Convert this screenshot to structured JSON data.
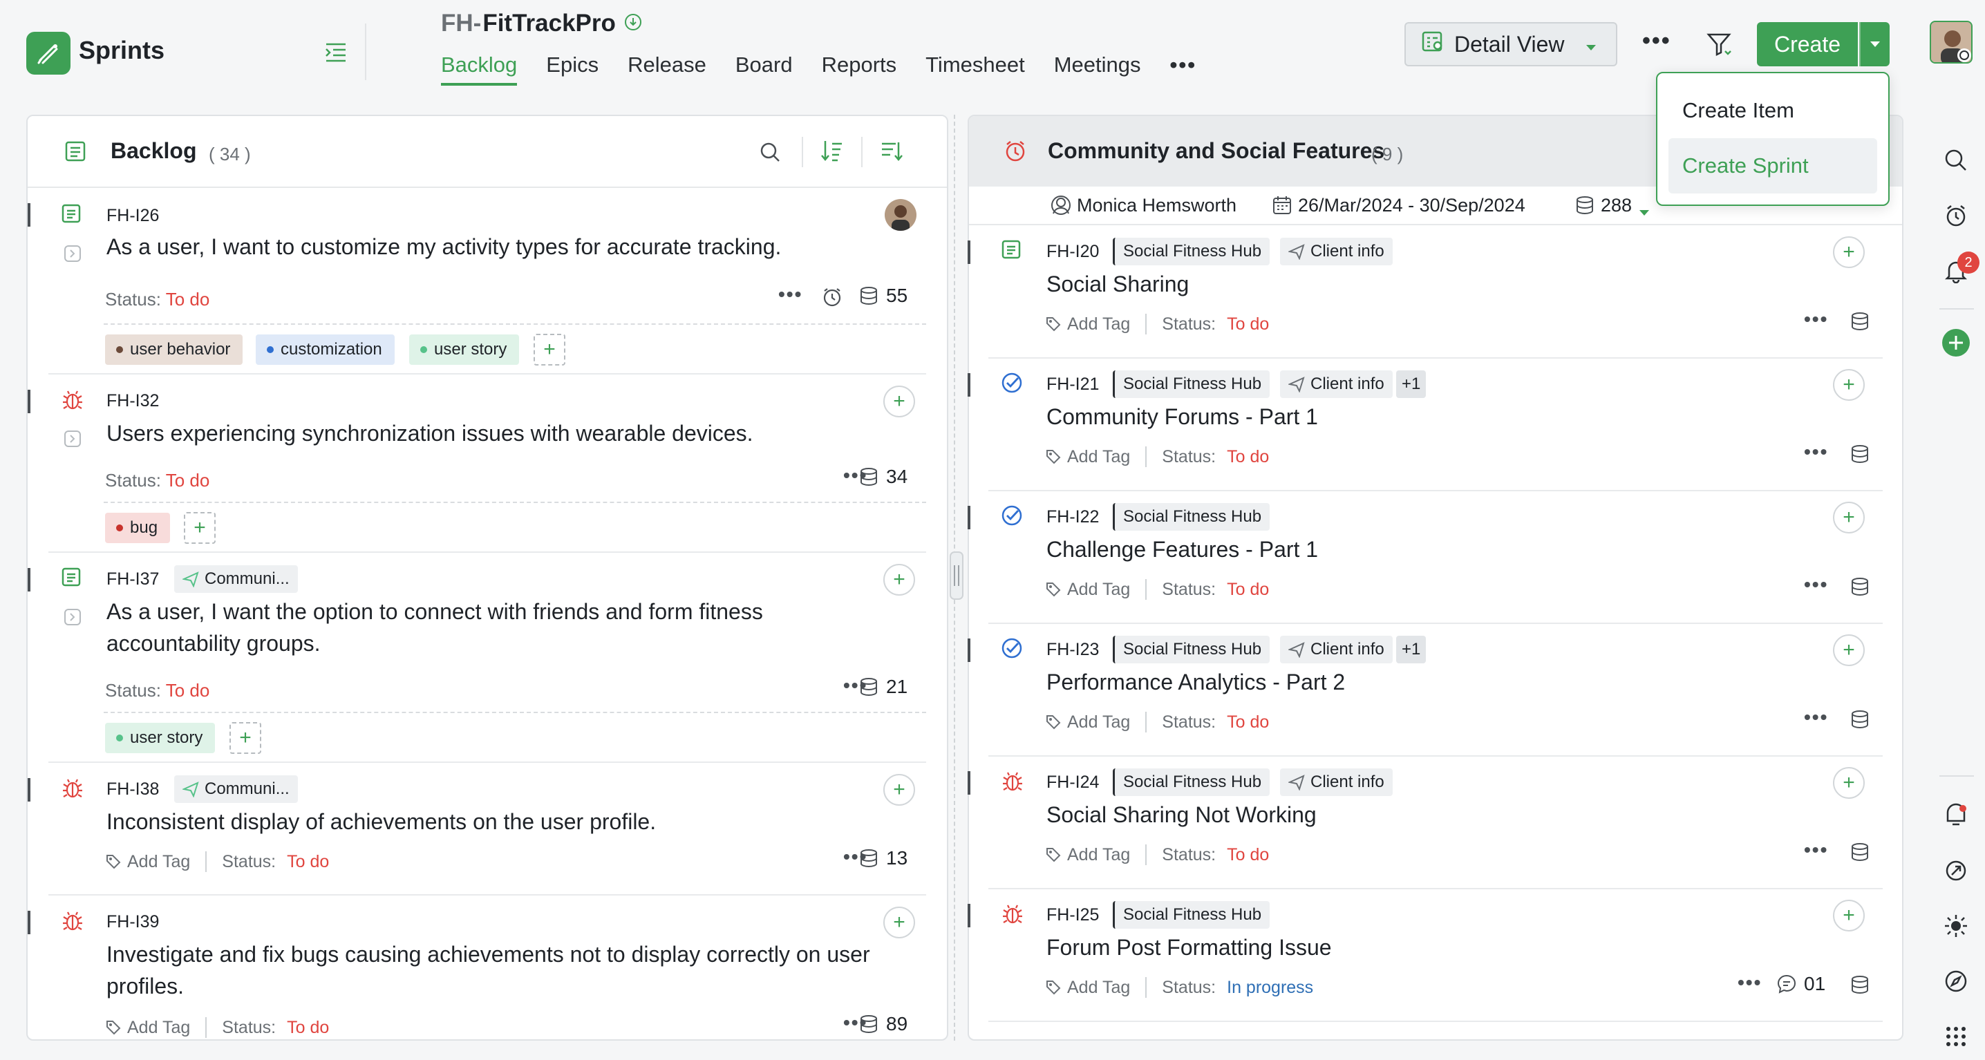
{
  "app": {
    "name": "Sprints"
  },
  "project": {
    "prefix": "FH-",
    "name": "FitTrackPro"
  },
  "nav": {
    "tabs": [
      {
        "label": "Backlog",
        "active": true
      },
      {
        "label": "Epics"
      },
      {
        "label": "Release"
      },
      {
        "label": "Board"
      },
      {
        "label": "Reports"
      },
      {
        "label": "Timesheet"
      },
      {
        "label": "Meetings"
      }
    ],
    "more": "•••"
  },
  "toolbar": {
    "view_label": "Detail View",
    "more": "•••",
    "create_label": "Create"
  },
  "create_menu": {
    "items": [
      {
        "label": "Create Item"
      },
      {
        "label": "Create Sprint",
        "highlighted": true
      }
    ]
  },
  "rail": {
    "notification_count": "2"
  },
  "backlog": {
    "title": "Backlog",
    "count": "( 34 )",
    "items": [
      {
        "id": "FH-I26",
        "type": "story",
        "title": "As a user, I want to customize my activity types for accurate tracking.",
        "status_label": "Status:",
        "status": "To do",
        "points": "55",
        "tags": [
          {
            "label": "user behavior",
            "color": "#6b4a3a",
            "bg": "#eadfd8"
          },
          {
            "label": "customization",
            "color": "#2f6fd1",
            "bg": "#dfe9f8"
          },
          {
            "label": "user story",
            "color": "#57c28a",
            "bg": "#dff3e8"
          }
        ]
      },
      {
        "id": "FH-I32",
        "type": "bug",
        "title": "Users experiencing synchronization issues with wearable devices.",
        "status_label": "Status:",
        "status": "To do",
        "points": "34",
        "tags": [
          {
            "label": "bug",
            "color": "#c8332d",
            "bg": "#f8dcdb"
          }
        ]
      },
      {
        "id": "FH-I37",
        "type": "story",
        "epic": "Communi...",
        "title": "As a user, I want the option to connect with friends and form fitness accountability groups.",
        "status_label": "Status:",
        "status": "To do",
        "points": "21",
        "tags": [
          {
            "label": "user story",
            "color": "#57c28a",
            "bg": "#dff3e8"
          }
        ]
      },
      {
        "id": "FH-I38",
        "type": "bug",
        "epic": "Communi...",
        "title": "Inconsistent display of achievements on the user profile.",
        "add_tag": "Add Tag",
        "status_label": "Status:",
        "status": "To do",
        "points": "13"
      },
      {
        "id": "FH-I39",
        "type": "bug",
        "title": "Investigate and fix bugs causing achievements not to display correctly on user profiles.",
        "add_tag": "Add Tag",
        "status_label": "Status:",
        "status": "To do",
        "points": "89"
      }
    ]
  },
  "sprint": {
    "title": "Community and Social Features",
    "count": "( 9 )",
    "owner": "Monica Hemsworth",
    "dates": "26/Mar/2024 - 30/Sep/2024",
    "points": "288",
    "items": [
      {
        "id": "FH-I20",
        "type": "story",
        "epic": "Social Fitness Hub",
        "release": "Client info",
        "title": "Social Sharing",
        "add_tag": "Add Tag",
        "status_label": "Status:",
        "status": "To do"
      },
      {
        "id": "FH-I21",
        "type": "task",
        "epic": "Social Fitness Hub",
        "release": "Client info",
        "extra": "+1",
        "title": "Community Forums - Part 1",
        "add_tag": "Add Tag",
        "status_label": "Status:",
        "status": "To do"
      },
      {
        "id": "FH-I22",
        "type": "task",
        "epic": "Social Fitness Hub",
        "title": "Challenge Features - Part 1",
        "add_tag": "Add Tag",
        "status_label": "Status:",
        "status": "To do"
      },
      {
        "id": "FH-I23",
        "type": "task",
        "epic": "Social Fitness Hub",
        "release": "Client info",
        "extra": "+1",
        "title": "Performance Analytics - Part 2",
        "add_tag": "Add Tag",
        "status_label": "Status:",
        "status": "To do"
      },
      {
        "id": "FH-I24",
        "type": "bug",
        "epic": "Social Fitness Hub",
        "release": "Client info",
        "title": "Social Sharing Not Working",
        "add_tag": "Add Tag",
        "status_label": "Status:",
        "status": "To do"
      },
      {
        "id": "FH-I25",
        "type": "bug",
        "epic": "Social Fitness Hub",
        "title": "Forum Post Formatting Issue",
        "add_tag": "Add Tag",
        "status_label": "Status:",
        "status": "In progress",
        "comments": "01"
      }
    ]
  },
  "colors": {
    "accent": "#3ea055",
    "todo": "#e0453f",
    "in_progress": "#2f6fb5"
  }
}
